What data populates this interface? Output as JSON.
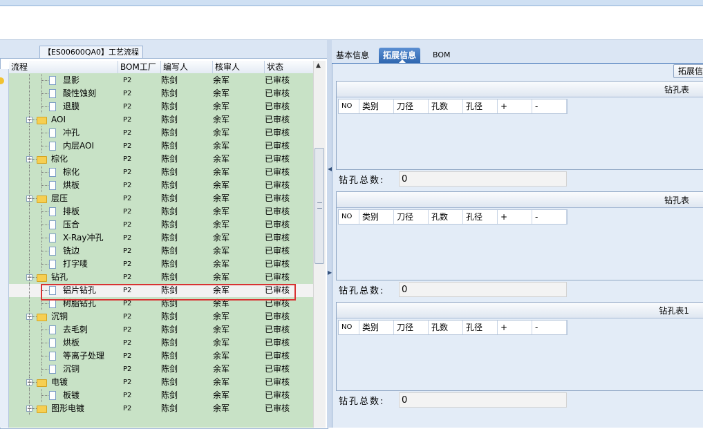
{
  "left_panel": {
    "title": "【ES00600QA0】工艺流程",
    "columns": [
      "流程",
      "BOM工厂",
      "编写人",
      "核审人",
      "状态"
    ],
    "rows": [
      {
        "name": "显影",
        "type": "doc",
        "bom": "P2",
        "writer": "陈剑",
        "reviewer": "余军",
        "status": "已审核"
      },
      {
        "name": "酸性蚀刻",
        "type": "doc",
        "bom": "P2",
        "writer": "陈剑",
        "reviewer": "余军",
        "status": "已审核"
      },
      {
        "name": "退膜",
        "type": "doc",
        "bom": "P2",
        "writer": "陈剑",
        "reviewer": "余军",
        "status": "已审核"
      },
      {
        "name": "AOI",
        "type": "folder",
        "bom": "P2",
        "writer": "陈剑",
        "reviewer": "余军",
        "status": "已审核"
      },
      {
        "name": "冲孔",
        "type": "doc",
        "bom": "P2",
        "writer": "陈剑",
        "reviewer": "余军",
        "status": "已审核"
      },
      {
        "name": "内层AOI",
        "type": "doc",
        "bom": "P2",
        "writer": "陈剑",
        "reviewer": "余军",
        "status": "已审核"
      },
      {
        "name": "棕化",
        "type": "folder",
        "bom": "P2",
        "writer": "陈剑",
        "reviewer": "余军",
        "status": "已审核"
      },
      {
        "name": "棕化",
        "type": "doc",
        "bom": "P2",
        "writer": "陈剑",
        "reviewer": "余军",
        "status": "已审核"
      },
      {
        "name": "烘板",
        "type": "doc",
        "bom": "P2",
        "writer": "陈剑",
        "reviewer": "余军",
        "status": "已审核"
      },
      {
        "name": "层压",
        "type": "folder",
        "bom": "P2",
        "writer": "陈剑",
        "reviewer": "余军",
        "status": "已审核"
      },
      {
        "name": "排板",
        "type": "doc",
        "bom": "P2",
        "writer": "陈剑",
        "reviewer": "余军",
        "status": "已审核"
      },
      {
        "name": "压合",
        "type": "doc",
        "bom": "P2",
        "writer": "陈剑",
        "reviewer": "余军",
        "status": "已审核"
      },
      {
        "name": "X-Ray冲孔",
        "type": "doc",
        "bom": "P2",
        "writer": "陈剑",
        "reviewer": "余军",
        "status": "已审核"
      },
      {
        "name": "铣边",
        "type": "doc",
        "bom": "P2",
        "writer": "陈剑",
        "reviewer": "余军",
        "status": "已审核"
      },
      {
        "name": "打字唛",
        "type": "doc",
        "bom": "P2",
        "writer": "陈剑",
        "reviewer": "余军",
        "status": "已审核"
      },
      {
        "name": "钻孔",
        "type": "folder",
        "bom": "P2",
        "writer": "陈剑",
        "reviewer": "余军",
        "status": "已审核"
      },
      {
        "name": "铝片钻孔",
        "type": "doc",
        "bom": "P2",
        "writer": "陈剑",
        "reviewer": "余军",
        "status": "已审核",
        "selected": true
      },
      {
        "name": "树脂钻孔",
        "type": "doc",
        "bom": "P2",
        "writer": "陈剑",
        "reviewer": "余军",
        "status": "已审核"
      },
      {
        "name": "沉铜",
        "type": "folder",
        "bom": "P2",
        "writer": "陈剑",
        "reviewer": "余军",
        "status": "已审核"
      },
      {
        "name": "去毛刺",
        "type": "doc",
        "bom": "P2",
        "writer": "陈剑",
        "reviewer": "余军",
        "status": "已审核"
      },
      {
        "name": "烘板",
        "type": "doc",
        "bom": "P2",
        "writer": "陈剑",
        "reviewer": "余军",
        "status": "已审核"
      },
      {
        "name": "等离子处理",
        "type": "doc",
        "bom": "P2",
        "writer": "陈剑",
        "reviewer": "余军",
        "status": "已审核"
      },
      {
        "name": "沉铜",
        "type": "doc",
        "bom": "P2",
        "writer": "陈剑",
        "reviewer": "余军",
        "status": "已审核"
      },
      {
        "name": "电镀",
        "type": "folder",
        "bom": "P2",
        "writer": "陈剑",
        "reviewer": "余军",
        "status": "已审核"
      },
      {
        "name": "板镀",
        "type": "doc",
        "bom": "P2",
        "writer": "陈剑",
        "reviewer": "余军",
        "status": "已审核"
      },
      {
        "name": "图形电镀",
        "type": "folder",
        "bom": "P2",
        "writer": "陈剑",
        "reviewer": "余军",
        "status": "已审核"
      }
    ]
  },
  "right_panel": {
    "tabs": [
      {
        "label": "基本信息",
        "active": false
      },
      {
        "label": "拓展信息",
        "active": true
      },
      {
        "label": "BOM",
        "active": false
      }
    ],
    "ext_button": "拓展信",
    "sections": [
      {
        "title": "钻孔表",
        "columns": [
          "NO",
          "类别",
          "刀径",
          "孔数",
          "孔径",
          "+",
          "-"
        ],
        "total_label": "钻孔总数:",
        "total_value": "0"
      },
      {
        "title": "钻孔表",
        "columns": [
          "NO",
          "类别",
          "刀径",
          "孔数",
          "孔径",
          "+",
          "-"
        ],
        "total_label": "钻孔总数:",
        "total_value": "0"
      },
      {
        "title": "钻孔表1",
        "columns": [
          "NO",
          "类别",
          "刀径",
          "孔数",
          "孔径",
          "+",
          "-"
        ],
        "total_label": "钻孔总数:",
        "total_value": "0"
      }
    ]
  },
  "colors": {
    "row_bg": "#c8e2c6",
    "selection_outline": "#d83232",
    "active_tab": "#2f67b0"
  }
}
